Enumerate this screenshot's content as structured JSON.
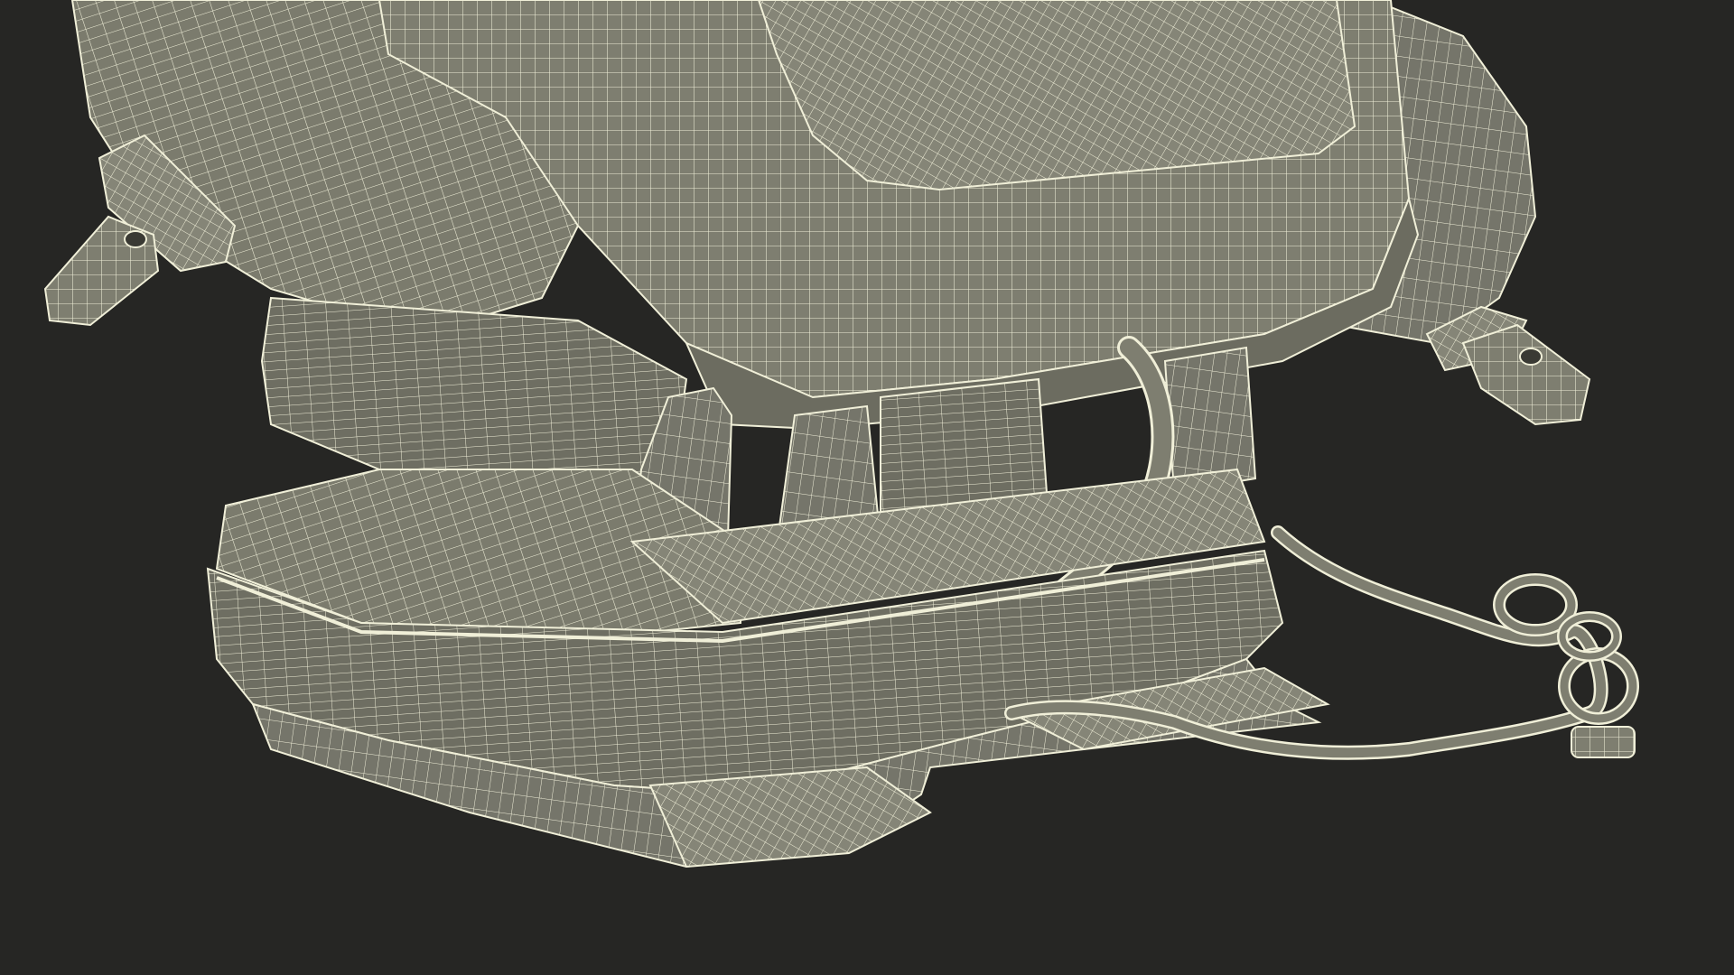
{
  "scene": {
    "subject": "",
    "colors": {
      "background": "#262624",
      "surface": "#7e7e70",
      "surface_light": "#8f8f80",
      "surface_dark": "#66665a",
      "wire": "#f0efd8"
    }
  }
}
